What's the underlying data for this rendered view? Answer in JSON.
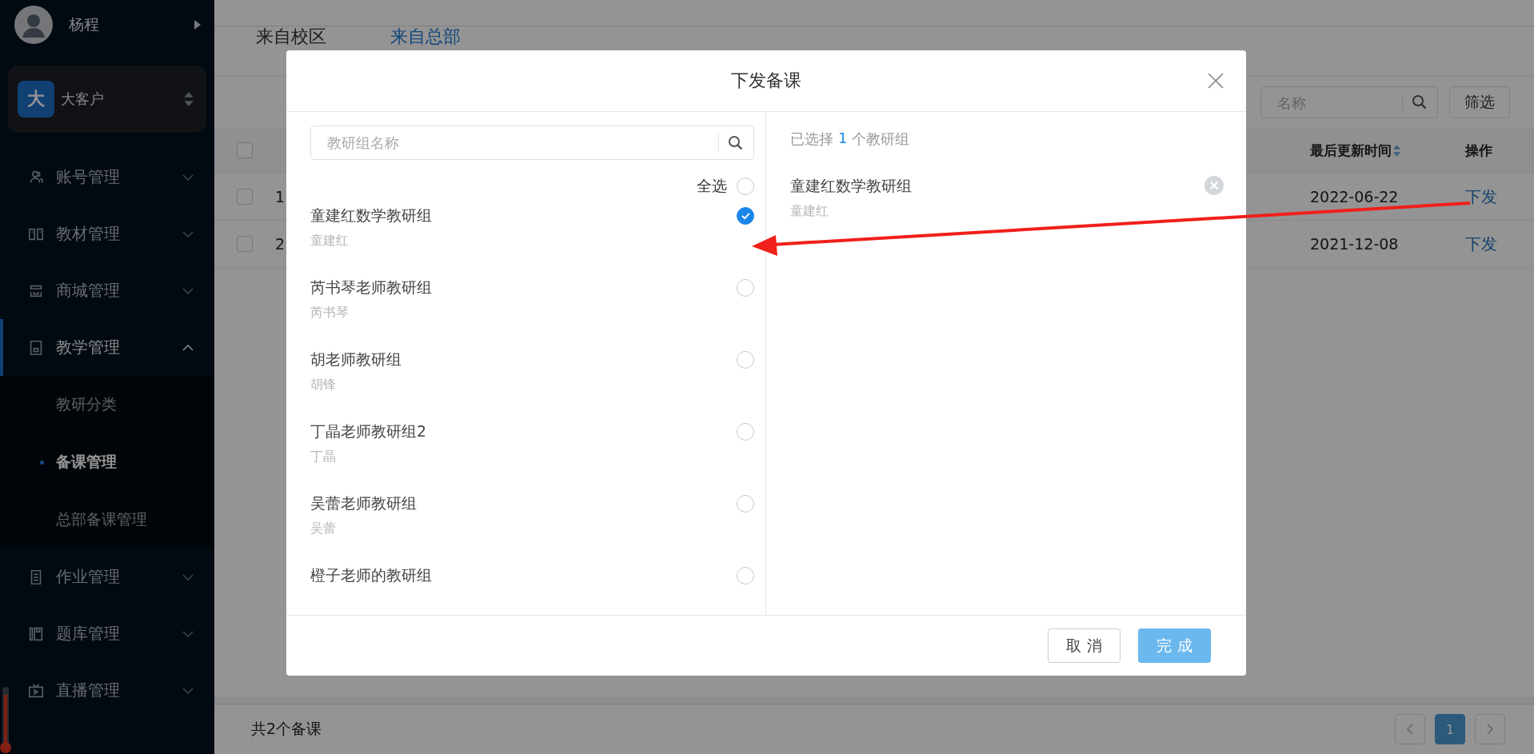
{
  "sidebar": {
    "user": "杨程",
    "customer": {
      "badge": "大",
      "name": "大客户"
    },
    "menu": [
      {
        "label": "账号管理",
        "expanded": false,
        "selected": false
      },
      {
        "label": "教材管理",
        "expanded": false,
        "selected": false
      },
      {
        "label": "商城管理",
        "expanded": false,
        "selected": false
      },
      {
        "label": "教学管理",
        "expanded": true,
        "selected": true,
        "children": [
          {
            "label": "教研分类",
            "selected": false
          },
          {
            "label": "备课管理",
            "selected": true
          },
          {
            "label": "总部备课管理",
            "selected": false
          }
        ]
      },
      {
        "label": "作业管理",
        "expanded": false,
        "selected": false
      },
      {
        "label": "题库管理",
        "expanded": false,
        "selected": false
      },
      {
        "label": "直播管理",
        "expanded": false,
        "selected": false
      }
    ]
  },
  "tabs": [
    {
      "label": "来自校区",
      "selected": false
    },
    {
      "label": "来自总部",
      "selected": true
    }
  ],
  "toolbar": {
    "search_placeholder": "名称",
    "filter_button": "筛选"
  },
  "table": {
    "all_checked": false,
    "columns": [
      "最后更新时间",
      "操作"
    ],
    "rows": [
      {
        "column_1": "1",
        "updated": "2022-06-22",
        "action": "下发",
        "checked": false
      },
      {
        "column_1": "2",
        "updated": "2021-12-08",
        "action": "下发",
        "checked": false
      }
    ]
  },
  "footer": {
    "total": "共2个备课",
    "pages": [
      {
        "label": "1",
        "selected": true
      }
    ]
  },
  "modal": {
    "title": "下发备课",
    "search_placeholder": "教研组名称",
    "select_all": {
      "label": "全选",
      "checked": false
    },
    "groups": [
      {
        "name": "童建红数学教研组",
        "owner": "童建红",
        "checked": true
      },
      {
        "name": "芮书琴老师教研组",
        "owner": "芮书琴",
        "checked": false
      },
      {
        "name": "胡老师教研组",
        "owner": "胡锋",
        "checked": false
      },
      {
        "name": "丁晶老师教研组2",
        "owner": "丁晶",
        "checked": false
      },
      {
        "name": "吴蕾老师教研组",
        "owner": "吴蕾",
        "checked": false
      },
      {
        "name": "橙子老师的教研组",
        "checked": false
      }
    ],
    "selected_prefix": "已选择",
    "selected_count": "1",
    "selected_suffix": "个教研组",
    "selected": [
      {
        "name": "童建红数学教研组",
        "owner": "童建红"
      }
    ],
    "cancel_button": "取 消",
    "confirm_button": "完 成"
  }
}
